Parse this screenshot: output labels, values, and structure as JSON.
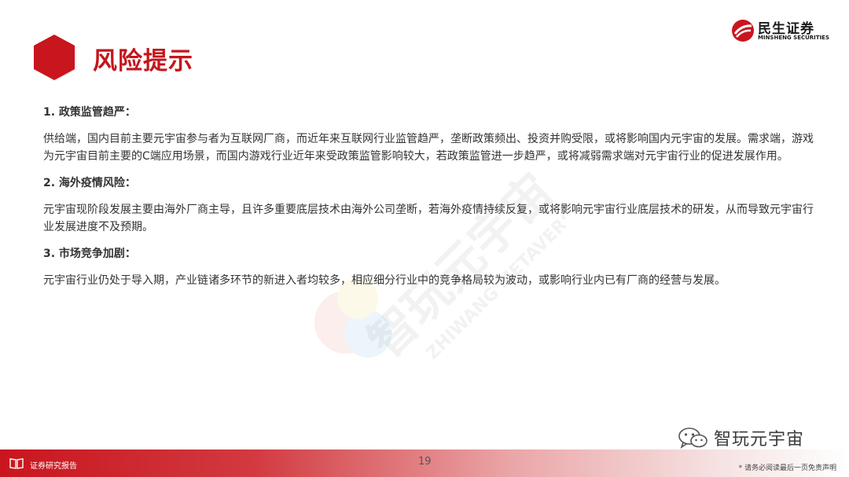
{
  "header": {
    "title": "风险提示",
    "logo_name": "民生证券",
    "logo_en": "MINSHENG SECURITIES"
  },
  "sections": [
    {
      "title": "1. 政策监管趋严：",
      "body": "供给端，国内目前主要元宇宙参与者为互联网厂商，而近年来互联网行业监管趋严，垄断政策频出、投资并购受限，或将影响国内元宇宙的发展。需求端，游戏为元宇宙目前主要的C端应用场景，而国内游戏行业近年来受政策监管影响较大，若政策监管进一步趋严，或将减弱需求端对元宇宙行业的促进发展作用。"
    },
    {
      "title": "2. 海外疫情风险：",
      "body": "元宇宙现阶段发展主要由海外厂商主导，且许多重要底层技术由海外公司垄断，若海外疫情持续反复，或将影响元宇宙行业底层技术的研发，从而导致元宇宙行业发展进度不及预期。"
    },
    {
      "title": "3. 市场竞争加剧：",
      "body": "元宇宙行业仍处于导入期，产业链诸多环节的新进入者均较多，相应细分行业中的竞争格局较为波动，或影响行业内已有厂商的经营与发展。"
    }
  ],
  "watermark": {
    "cn": "智玩元宇宙",
    "en": "ZHIWANG METAVERSE"
  },
  "wechat": {
    "name": "智玩元宇宙"
  },
  "footer": {
    "label": "证券研究报告",
    "page_number": "19",
    "disclaimer": "* 请务必阅读最后一页免责声明"
  },
  "colors": {
    "brand_red": "#c4161c"
  }
}
